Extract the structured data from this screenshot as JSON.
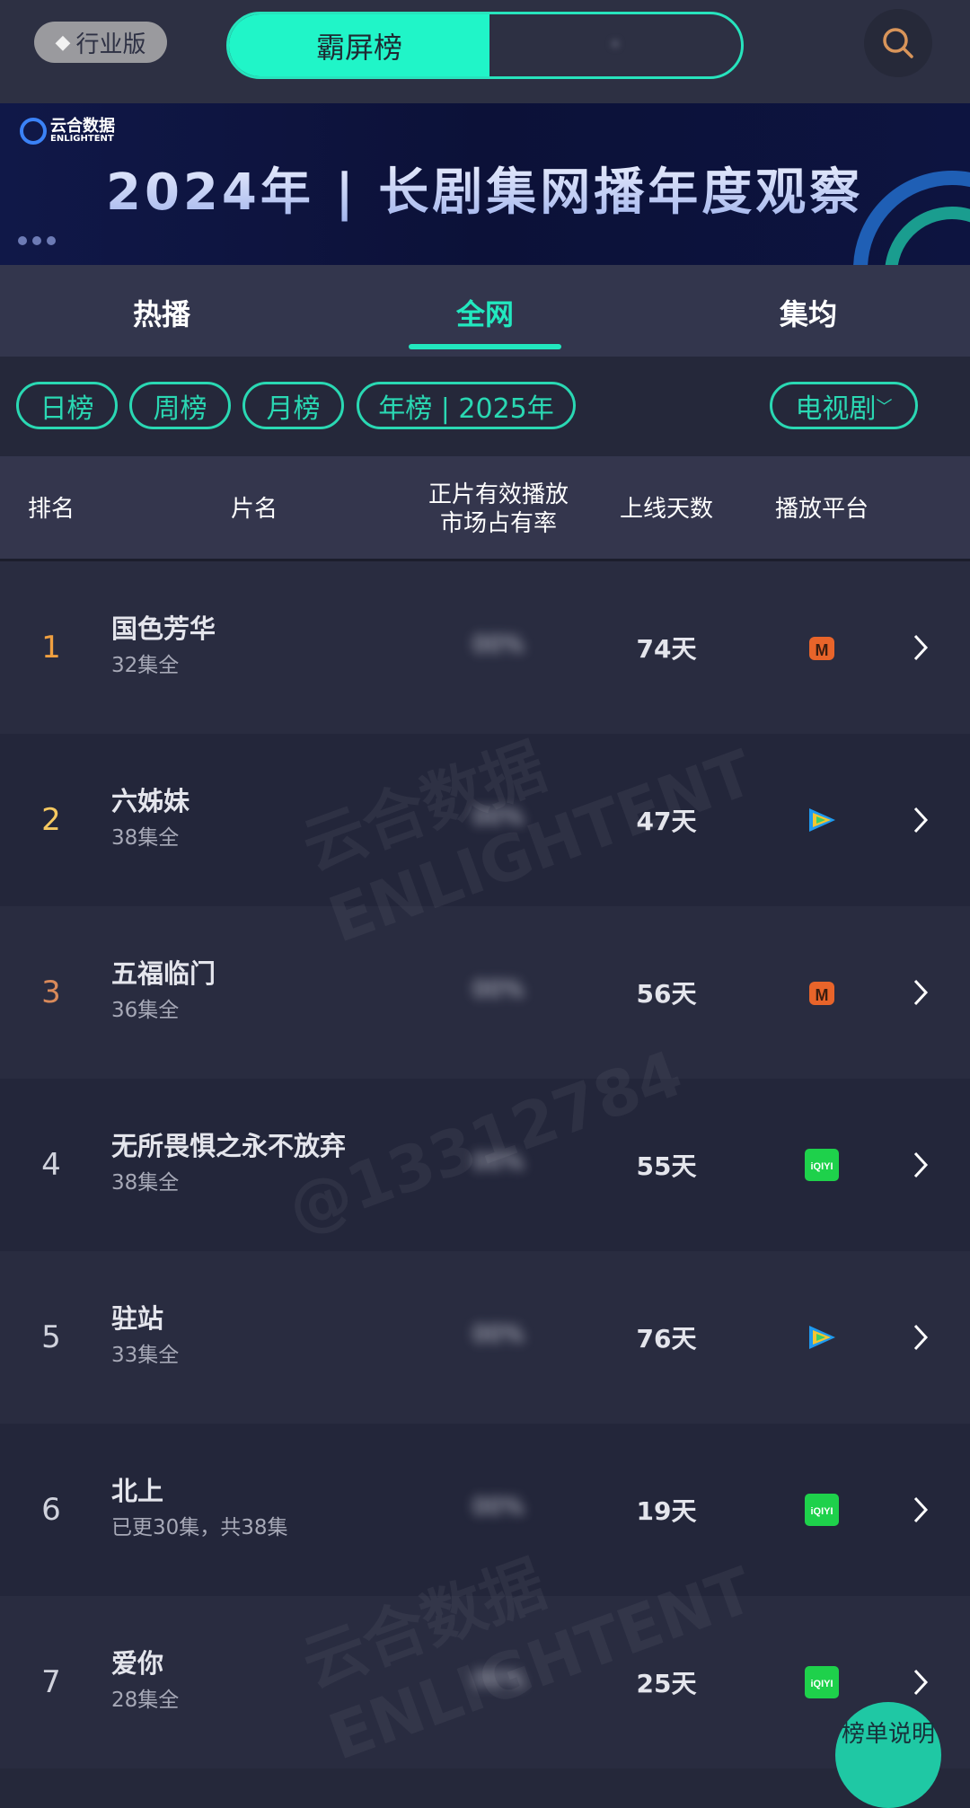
{
  "topbar": {
    "edition_label": "行业版",
    "segments": [
      "霸屏榜",
      "•"
    ],
    "search_icon": "search-icon"
  },
  "banner": {
    "logo_cn": "云合数据",
    "logo_en": "ENLIGHTENT",
    "title": "2024年 | 长剧集网播年度观察"
  },
  "tabs": [
    {
      "label": "热播"
    },
    {
      "label": "全网",
      "active": true
    },
    {
      "label": "集均"
    }
  ],
  "filters": {
    "periods": [
      "日榜",
      "周榜",
      "月榜",
      "年榜 | 2025年"
    ],
    "category": "电视剧"
  },
  "table": {
    "headers": {
      "rank": "排名",
      "title": "片名",
      "share": "正片有效播放\n市场占有率",
      "days": "上线天数",
      "platform": "播放平台"
    },
    "rows": [
      {
        "rank": "1",
        "title": "国色芳华",
        "episodes": "32集全",
        "days": "74天",
        "platform": "mango-tv"
      },
      {
        "rank": "2",
        "title": "六姊妹",
        "episodes": "38集全",
        "days": "47天",
        "platform": "tencent-video"
      },
      {
        "rank": "3",
        "title": "五福临门",
        "episodes": "36集全",
        "days": "56天",
        "platform": "mango-tv"
      },
      {
        "rank": "4",
        "title": "无所畏惧之永不放弃",
        "episodes": "38集全",
        "days": "55天",
        "platform": "iqiyi"
      },
      {
        "rank": "5",
        "title": "驻站",
        "episodes": "33集全",
        "days": "76天",
        "platform": "tencent-video"
      },
      {
        "rank": "6",
        "title": "北上",
        "episodes": "已更30集，共38集",
        "days": "19天",
        "platform": "iqiyi"
      },
      {
        "rank": "7",
        "title": "爱你",
        "episodes": "28集全",
        "days": "25天",
        "platform": "iqiyi"
      }
    ]
  },
  "watermark": {
    "brand": "云合数据 ENLIGHTENT",
    "user": "@13312784"
  },
  "fab_label": "榜单说明",
  "colors": {
    "accent": "#22e8bf",
    "rank1": "#f0a040",
    "rank2": "#f5c860",
    "rank3": "#d98a5a",
    "mango": "#e8642a",
    "iqiyi": "#1ed14b"
  }
}
